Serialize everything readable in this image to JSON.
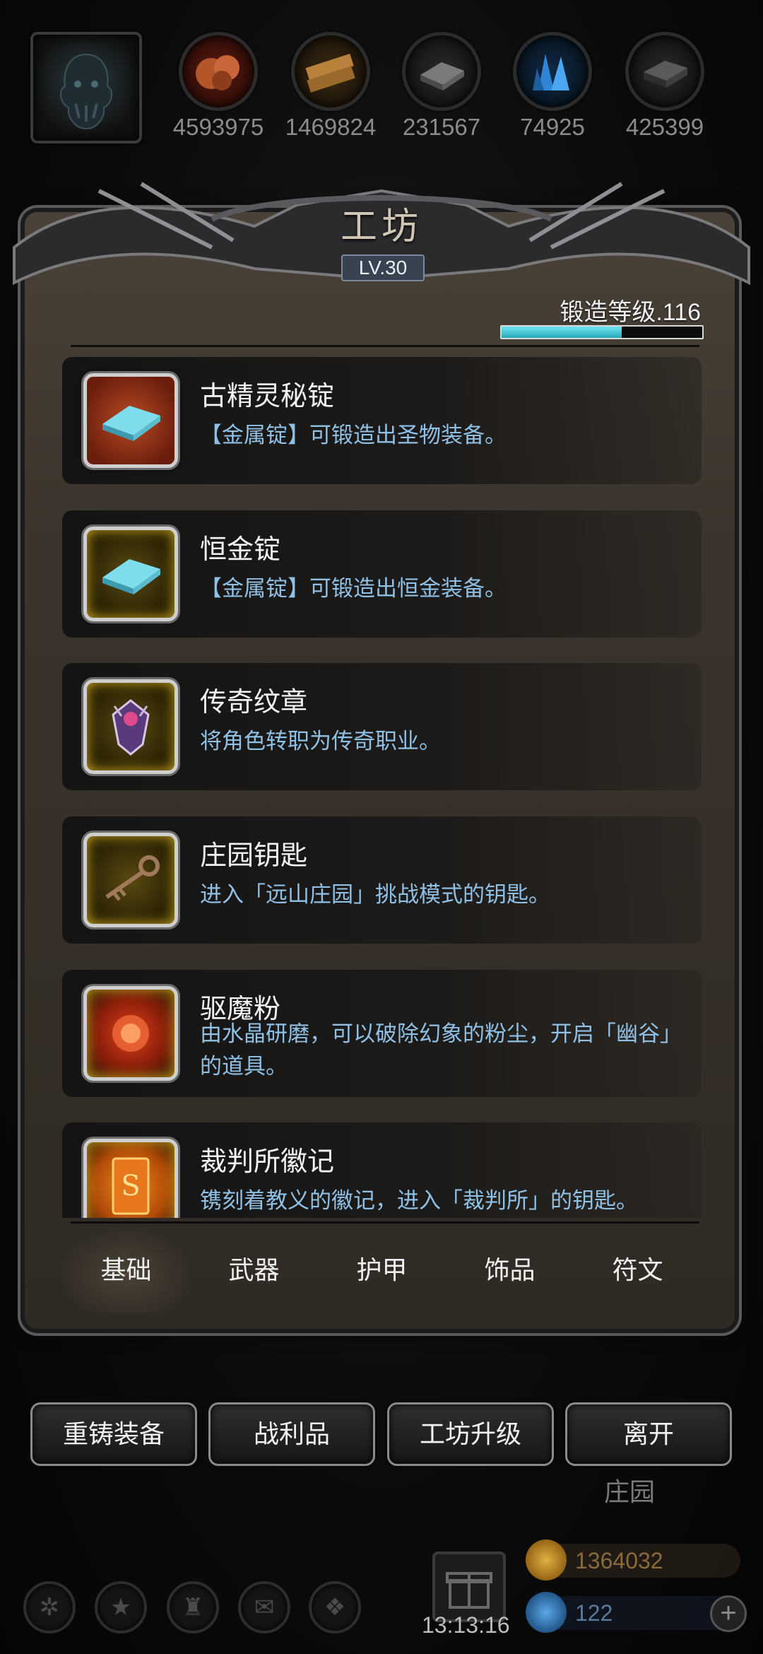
{
  "resources": [
    {
      "icon": "copper-ore-icon",
      "amount": "4593975"
    },
    {
      "icon": "wood-plank-icon",
      "amount": "1469824"
    },
    {
      "icon": "iron-ingot-icon",
      "amount": "231567"
    },
    {
      "icon": "crystal-icon",
      "amount": "74925"
    },
    {
      "icon": "dark-ingot-icon",
      "amount": "425399"
    }
  ],
  "panel": {
    "title": "工坊",
    "level_badge": "LV.30",
    "forge_level_label": "锻造等级.116",
    "forge_progress": 0.6
  },
  "items": [
    {
      "name": "古精灵秘锭",
      "desc": "【金属锭】可锻造出圣物装备。",
      "icon": "blue-ingot-icon"
    },
    {
      "name": "恒金锭",
      "desc": "【金属锭】可锻造出恒金装备。",
      "icon": "blue-ingot-icon"
    },
    {
      "name": "传奇纹章",
      "desc": "将角色转职为传奇职业。",
      "icon": "emblem-icon"
    },
    {
      "name": "庄园钥匙",
      "desc": "进入「远山庄园」挑战模式的钥匙。",
      "icon": "key-icon"
    },
    {
      "name": "驱魔粉",
      "desc": "由水晶研磨，可以破除幻象的粉尘，开启「幽谷」的道具。",
      "icon": "powder-icon"
    },
    {
      "name": "裁判所徽记",
      "desc": "镌刻着教义的徽记，进入「裁判所」的钥匙。",
      "icon": "seal-icon"
    }
  ],
  "tabs": [
    "基础",
    "武器",
    "护甲",
    "饰品",
    "符文"
  ],
  "active_tab": "基础",
  "buttons": [
    "重铸装备",
    "战利品",
    "工坊升级",
    "离开"
  ],
  "location_label": "庄园",
  "hud": {
    "timer": "13:13:16",
    "gold": "1364032",
    "gems": "122"
  }
}
